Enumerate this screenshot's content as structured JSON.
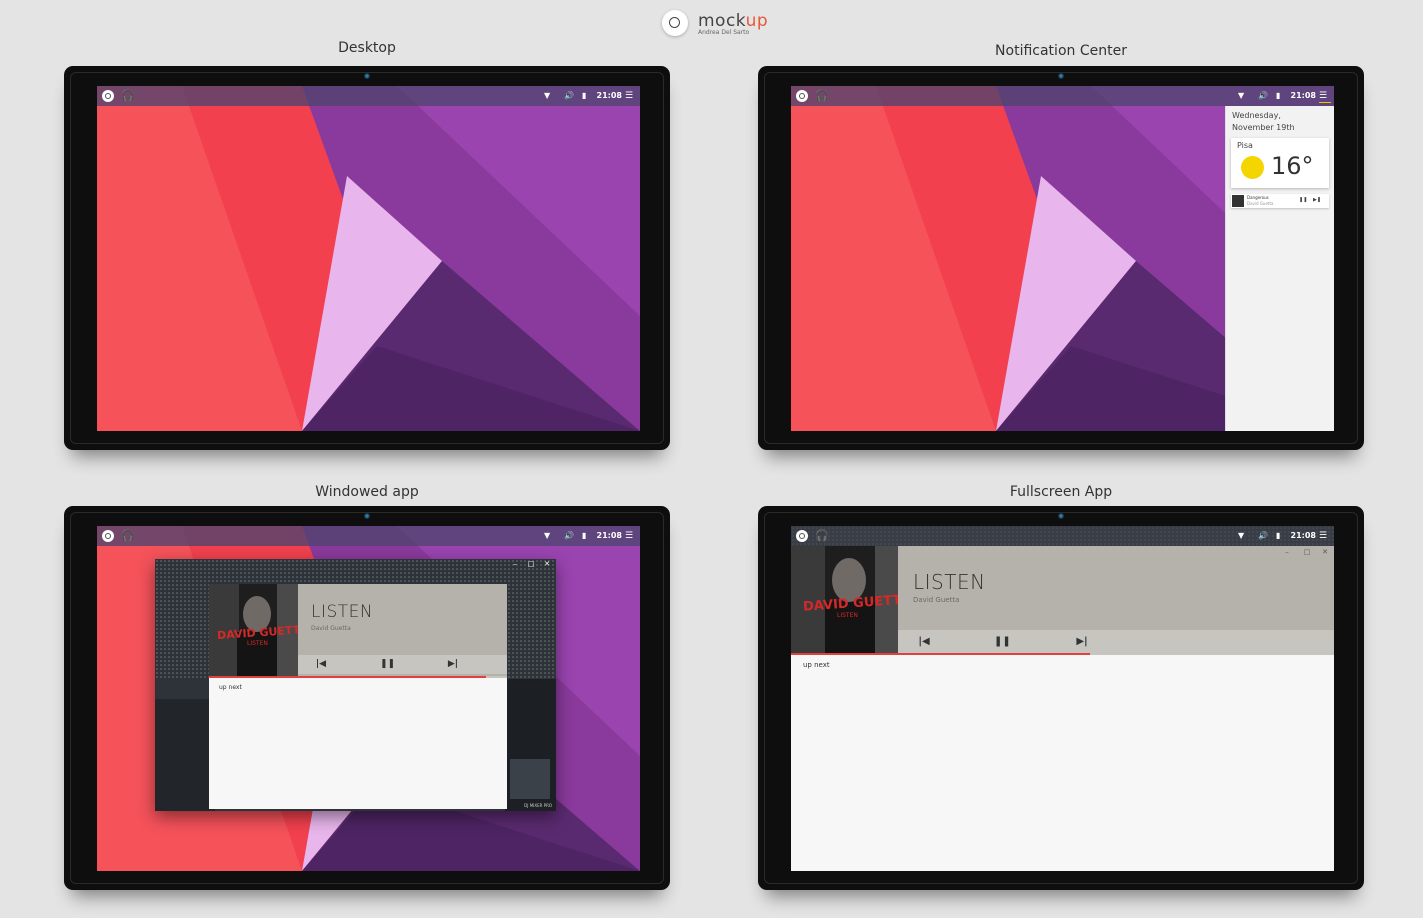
{
  "branding": {
    "name_main": "mock",
    "name_accent": "up",
    "author": "Andrea Del Sarto"
  },
  "panels": {
    "desktop": {
      "caption": "Desktop"
    },
    "notification": {
      "caption": "Notification Center"
    },
    "windowed": {
      "caption": "Windowed app"
    },
    "fullscreen": {
      "caption": "Fullscreen App"
    }
  },
  "topbar": {
    "time": "21:08",
    "icons": {
      "home": "circle-home-icon",
      "music": "headphones-icon",
      "wifi": "wifi-icon",
      "volume": "volume-icon",
      "battery": "battery-icon",
      "menu": "menu-icon"
    }
  },
  "notification_center": {
    "date_line1": "Wednesday,",
    "date_line2": "November 19th",
    "weather": {
      "city": "Pisa",
      "temperature": "16°",
      "icon": "sun-icon"
    },
    "music": {
      "title": "Dangerous",
      "artist": "David Guetta"
    }
  },
  "player": {
    "album_title": "DAVID GUETTA",
    "album_subtitle": "LISTEN",
    "track": "LISTEN",
    "artist": "David Guetta",
    "queue_label": "up next",
    "window_brand": "DJ MIXER PRO",
    "progress_windowed": 0.93,
    "progress_fullscreen": 0.55
  },
  "colors": {
    "accent_progress": "#e04040",
    "player_header": "#b4b2ab",
    "wallpaper_purple": "#8e3aa0",
    "wallpaper_red": "#f2404e"
  }
}
